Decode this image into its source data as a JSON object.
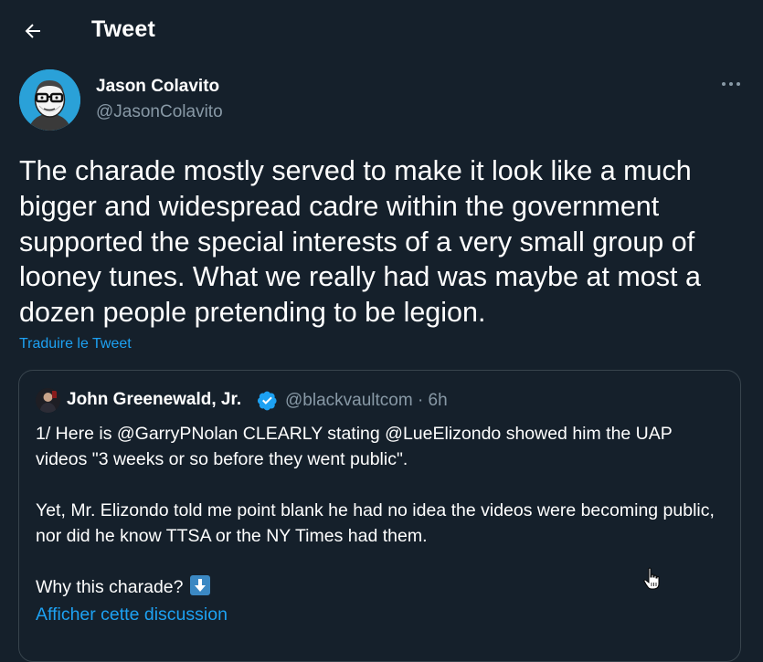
{
  "header": {
    "title": "Tweet",
    "back_icon": "arrow-left-icon"
  },
  "tweet": {
    "author_name": "Jason Colavito",
    "author_handle": "@JasonColavito",
    "more_icon": "more-horizontal-icon",
    "text": "The charade mostly served to make it look like a much bigger and widespread cadre within the government supported the special interests of a very small group of looney tunes. What we really had was maybe at most a dozen people pretending to be legion.",
    "translate_label": "Traduire le Tweet"
  },
  "quote": {
    "author_name": "John Greenewald, Jr.",
    "verified_icon": "verified-badge-icon",
    "handle_time": "@blackvaultcom · 6h",
    "text": "1/ Here is @GarryPNolan CLEARLY stating @LueElizondo showed him the UAP videos \"3 weeks or so before they went public\".\n\nYet, Mr. Elizondo told me point blank he had no idea the videos were becoming public, nor did he know TTSA or the NY Times had them.\n\nWhy this charade?",
    "emoji_icon": "down-arrow-emoji-icon",
    "show_thread_label": "Afficher cette discussion"
  },
  "colors": {
    "background": "#15202b",
    "text": "#ffffff",
    "secondary_text": "#8899a6",
    "link": "#1da1f2",
    "border": "#38444d",
    "verified": "#1da1f2"
  }
}
